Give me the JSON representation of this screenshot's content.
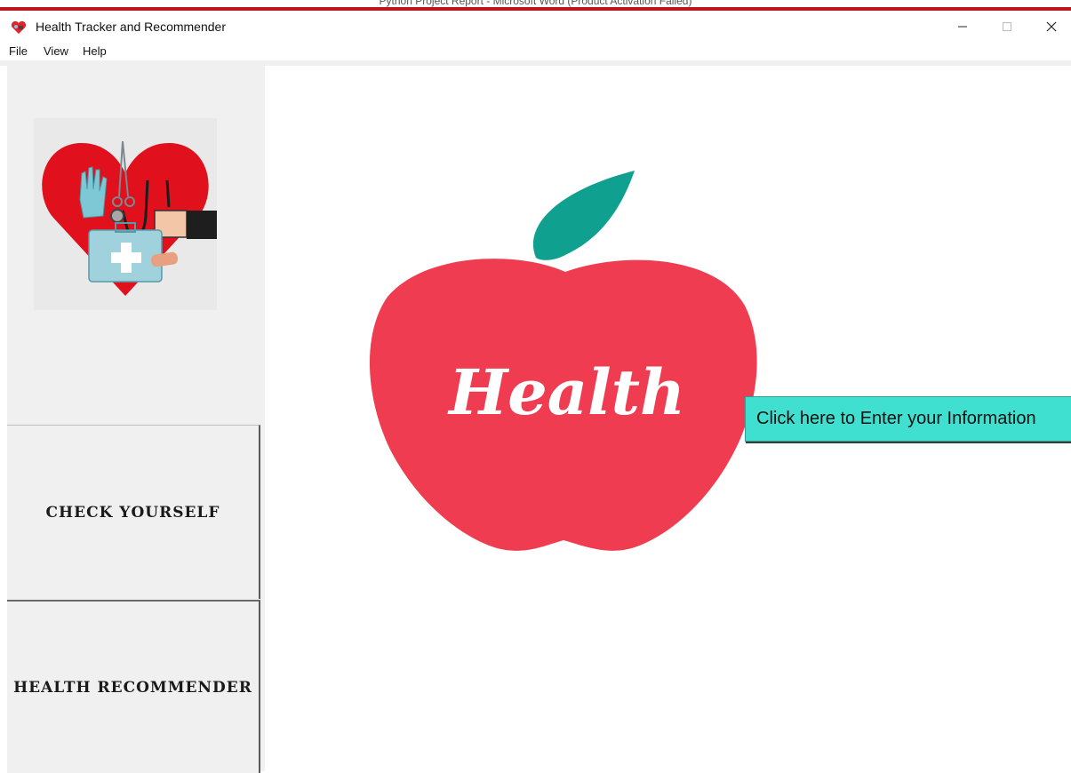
{
  "background_window": {
    "title": "Python Project Report - Microsoft Word (Product Activation Failed)"
  },
  "titlebar": {
    "title": "Health Tracker and Recommender",
    "app_icon": "heart-logo-icon",
    "minimize_icon": "minimize-icon",
    "maximize_icon": "maximize-icon",
    "close_icon": "close-icon"
  },
  "menu": {
    "file": "File",
    "view": "View",
    "help": "Help"
  },
  "sidebar": {
    "logo": "medical-heart-logo",
    "check_yourself": "CHECK YOURSELF",
    "health_recommender": "HEALTH RECOMMENDER"
  },
  "main": {
    "apple_text": "Health",
    "enter_button": "Click here to Enter your Information"
  },
  "colors": {
    "apple": "#f03c50",
    "leaf": "#10a090",
    "enter_button_bg": "#40e0d0",
    "sidebar_bg": "#f0f0f0",
    "accent_bar": "#c0141c"
  }
}
